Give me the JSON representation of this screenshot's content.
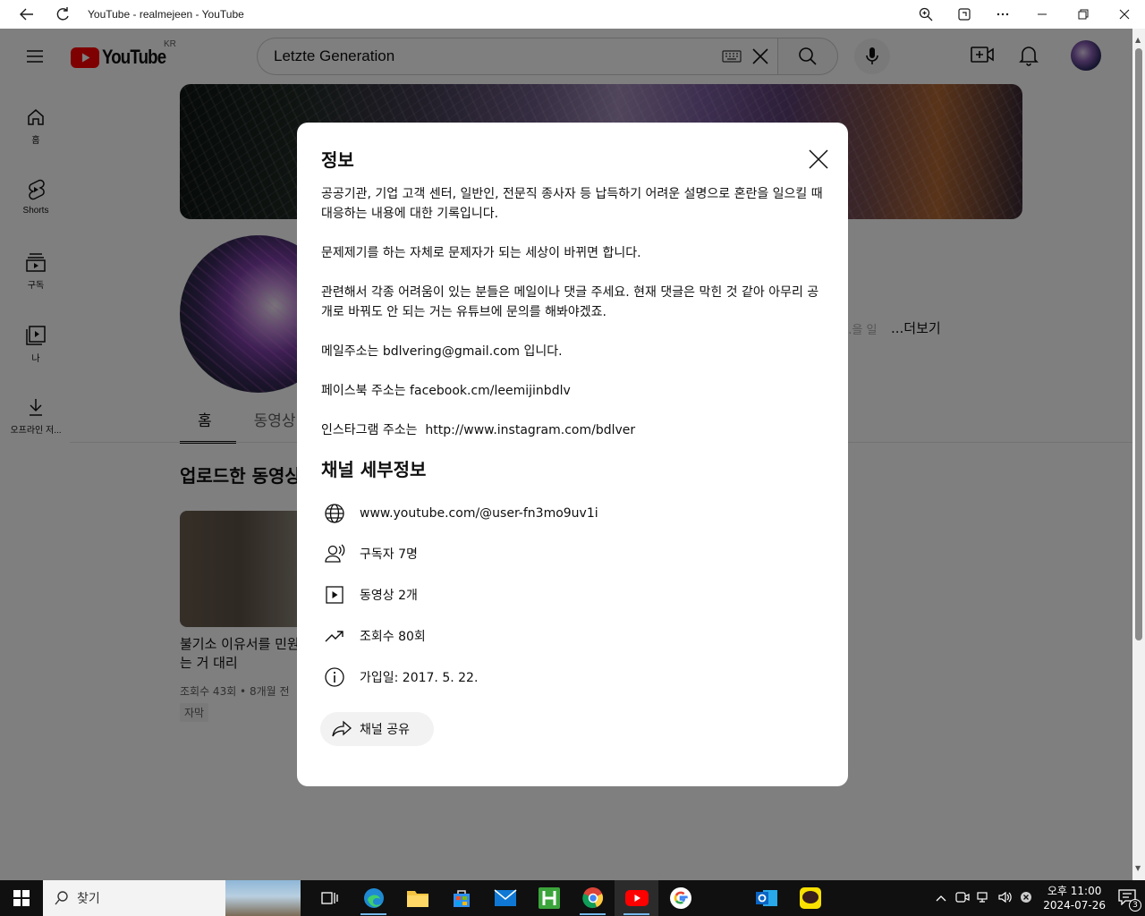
{
  "window": {
    "title": "YouTube - realmejeen - YouTube"
  },
  "masthead": {
    "logo_text": "YouTube",
    "country": "KR",
    "search_value": "Letzte Generation"
  },
  "guide": [
    {
      "label": "홈"
    },
    {
      "label": "Shorts"
    },
    {
      "label": "구독"
    },
    {
      "label": "나"
    },
    {
      "label": "오프라인 저..."
    }
  ],
  "channel": {
    "more_faded": "...을 일",
    "more_link": "...더보기",
    "tabs": [
      "홈",
      "동영상"
    ],
    "section_title": "업로드한 동영상",
    "video": {
      "title": "불기소 이유서를 민원으로 미리 작성하는 거 대리",
      "meta": "조회수 43회 • 8개월 전",
      "badge": "자막"
    }
  },
  "modal": {
    "title": "정보",
    "description": [
      "공공기관, 기업 고객 센터, 일반인, 전문직 종사자 등 납득하기 어려운 설명으로 혼란을 일으킬 때 대응하는 내용에 대한 기록입니다.",
      "문제제기를 하는 자체로 문제자가 되는 세상이 바뀌면 합니다.",
      "관련해서 각종 어려움이 있는 분들은 메일이나 댓글 주세요. 현재 댓글은 막힌 것 같아 아무리 공개로 바꿔도 안 되는 거는 유튜브에 문의를 해봐야겠죠.",
      "메일주소는 bdlvering@gmail.com 입니다.",
      "페이스북 주소는 facebook.cm/leemijinbdlv",
      "인스타그램 주소는  http://www.instagram.com/bdlver"
    ],
    "details_title": "채널 세부정보",
    "details": {
      "url": "www.youtube.com/@user-fn3mo9uv1i",
      "subscribers": "구독자 7명",
      "videos": "동영상 2개",
      "views": "조회수 80회",
      "joined": "가입일: 2017. 5. 22."
    },
    "share_label": "채널 공유"
  },
  "taskbar": {
    "search_label": "찾기",
    "time": "오후 11:00",
    "date": "2024-07-26",
    "notification_count": "3"
  },
  "colors": {
    "youtube_red": "#ff0000",
    "overlay": "#808080",
    "taskbar": "#101010"
  }
}
